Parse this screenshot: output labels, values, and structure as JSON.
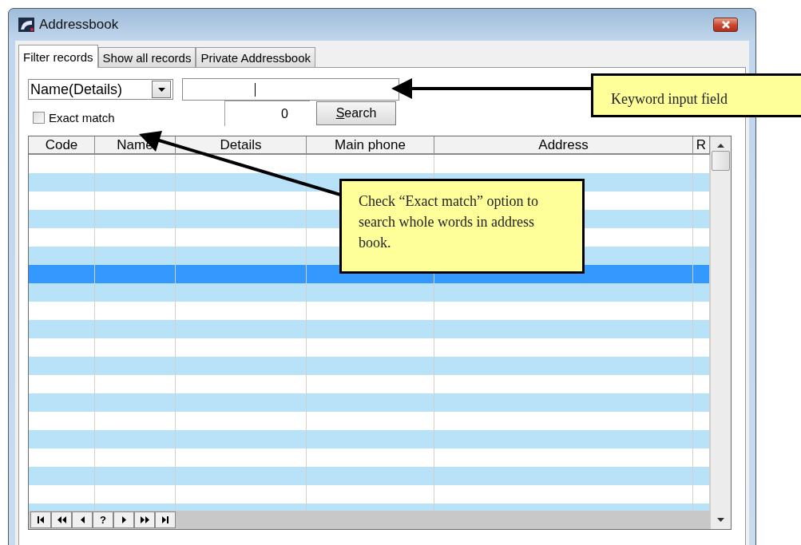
{
  "window": {
    "title": "Addressbook"
  },
  "tabs": [
    {
      "label": "Filter records",
      "selected": true
    },
    {
      "label": "Show all records",
      "selected": false
    },
    {
      "label": "Private Addressbook",
      "selected": false
    }
  ],
  "filter": {
    "field_select": {
      "value": "Name(Details)"
    },
    "exact_match": {
      "label": "Exact match",
      "checked": false
    },
    "count": {
      "value": "0"
    },
    "search_button": {
      "label": "Search"
    }
  },
  "table": {
    "columns": [
      "Code",
      "Name",
      "Details",
      "Main phone",
      "Address",
      "R"
    ],
    "rows": [
      {
        "selected": false
      },
      {
        "selected": false
      },
      {
        "selected": false
      },
      {
        "selected": false
      },
      {
        "selected": false
      },
      {
        "selected": false
      },
      {
        "selected": true
      },
      {
        "selected": false
      },
      {
        "selected": false
      },
      {
        "selected": false
      },
      {
        "selected": false
      },
      {
        "selected": false
      },
      {
        "selected": false
      },
      {
        "selected": false
      },
      {
        "selected": false
      },
      {
        "selected": false
      },
      {
        "selected": false
      },
      {
        "selected": false
      },
      {
        "selected": false
      },
      {
        "selected": false
      }
    ]
  },
  "navigator": [
    {
      "kind": "first"
    },
    {
      "kind": "prev_page"
    },
    {
      "kind": "prev"
    },
    {
      "kind": "text",
      "label": "?"
    },
    {
      "kind": "next"
    },
    {
      "kind": "next_page"
    },
    {
      "kind": "last"
    }
  ],
  "callouts": [
    {
      "kind": "keyword",
      "text": "Keyword input field"
    },
    {
      "kind": "exact",
      "text": "Check “Exact match” option to search whole words in address book."
    }
  ]
}
